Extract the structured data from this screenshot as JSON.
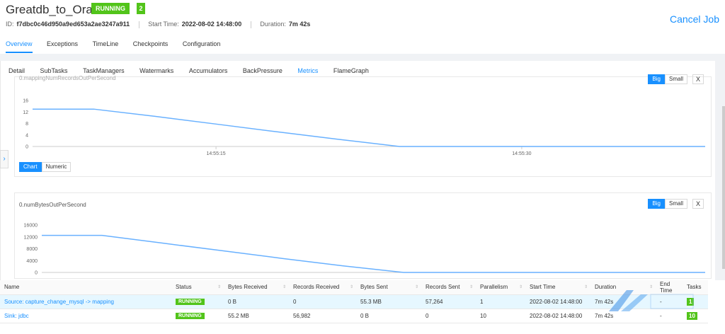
{
  "job": {
    "name": "Greatdb_to_Oracle",
    "status": "RUNNING",
    "task_count": "2",
    "id_label": "ID:",
    "id": "f7dbc0c46d950a9ed653a2ae3247a911",
    "start_label": "Start Time:",
    "start_time": "2022-08-02 14:48:00",
    "duration_label": "Duration:",
    "duration": "7m 42s",
    "cancel_label": "Cancel Job"
  },
  "job_tabs": [
    "Overview",
    "Exceptions",
    "TimeLine",
    "Checkpoints",
    "Configuration"
  ],
  "sub_tabs": [
    "Detail",
    "SubTasks",
    "TaskManagers",
    "Watermarks",
    "Accumulators",
    "BackPressure",
    "Metrics",
    "FlameGraph"
  ],
  "metric_controls": {
    "big": "Big",
    "small": "Small",
    "close": "X",
    "chart": "Chart",
    "numeric": "Numeric"
  },
  "metrics": [
    {
      "name": "0.mappingNumRecordsOutPerSecond",
      "chart_data": {
        "type": "line",
        "x": [
          "14:55:06",
          "14:55:09",
          "14:55:12",
          "14:55:15",
          "14:55:18",
          "14:55:21",
          "14:55:24",
          "14:55:27",
          "14:55:30",
          "14:55:33",
          "14:55:36",
          "14:55:39"
        ],
        "y_ticks": [
          0,
          4,
          8,
          12,
          16
        ],
        "x_ticks": [
          "14:55:15",
          "14:55:30"
        ],
        "series": [
          {
            "values": [
              13,
              13,
              10.5,
              7.8,
              5.1,
              2.5,
              0,
              0,
              0,
              0,
              0,
              0
            ]
          }
        ],
        "ylim": [
          0,
          16
        ],
        "color": "#69b1ff"
      }
    },
    {
      "name": "0.numBytesOutPerSecond",
      "chart_data": {
        "type": "line",
        "x": [
          "14:55:06",
          "14:55:09",
          "14:55:12",
          "14:55:15",
          "14:55:18",
          "14:55:21",
          "14:55:24",
          "14:55:27",
          "14:55:30",
          "14:55:33",
          "14:55:36",
          "14:55:39"
        ],
        "y_ticks": [
          0,
          4000,
          8000,
          12000,
          16000
        ],
        "x_ticks": [],
        "series": [
          {
            "values": [
              12500,
              12500,
              9900,
              7300,
              4700,
              2200,
              0,
              0,
              0,
              0,
              0,
              0
            ]
          }
        ],
        "ylim": [
          0,
          16000
        ],
        "color": "#69b1ff"
      }
    }
  ],
  "table": {
    "columns": [
      "Name",
      "Status",
      "Bytes Received",
      "Records Received",
      "Bytes Sent",
      "Records Sent",
      "Parallelism",
      "Start Time",
      "Duration",
      "End Time",
      "Tasks"
    ],
    "rows": [
      [
        "Source: capture_change_mysql -> mapping",
        "RUNNING",
        "0 B",
        "0",
        "55.3 MB",
        "57,264",
        "1",
        "2022-08-02 14:48:00",
        "7m 42s",
        "-",
        "1"
      ],
      [
        "Sink: jdbc",
        "RUNNING",
        "55.2 MB",
        "56,982",
        "0 B",
        "0",
        "10",
        "2022-08-02 14:48:00",
        "7m 42s",
        "-",
        "10"
      ]
    ]
  }
}
